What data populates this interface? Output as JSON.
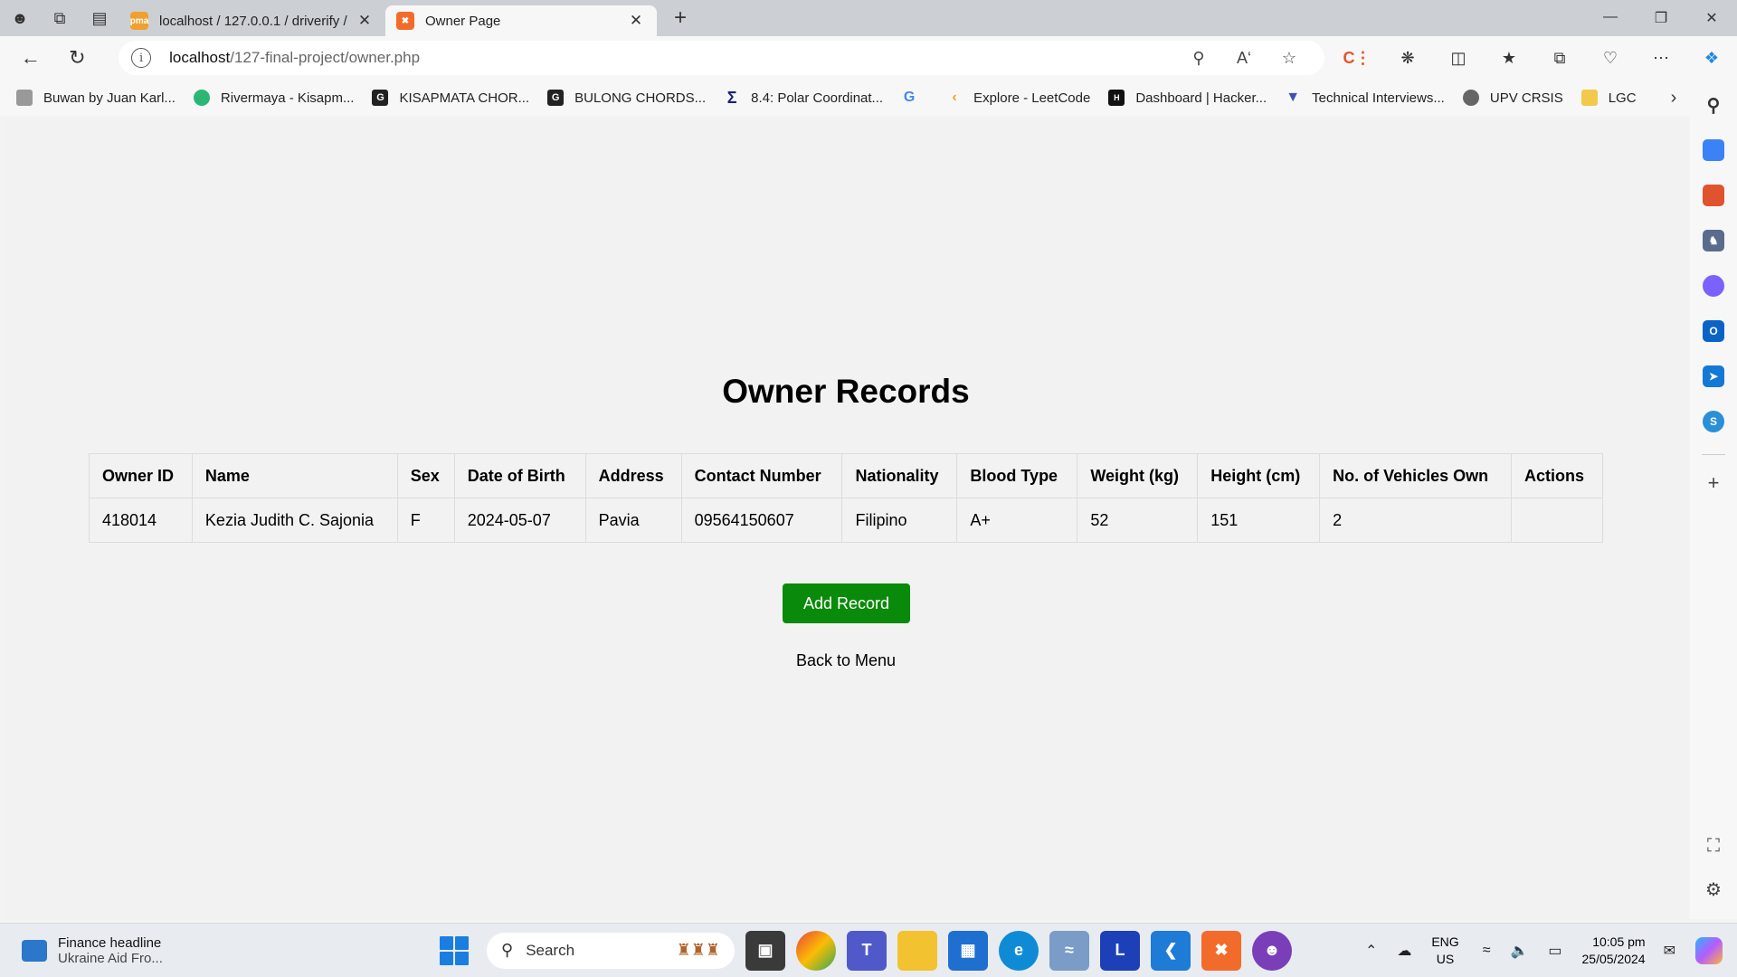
{
  "browser": {
    "tabs": [
      {
        "title": "localhost / 127.0.0.1 / driverify / ",
        "favicon": "phpmyadmin-icon",
        "active": false
      },
      {
        "title": "Owner Page",
        "favicon": "xampp-icon",
        "active": true
      }
    ],
    "url_host": "localhost",
    "url_path": "/127-final-project/owner.php",
    "favorites": [
      {
        "label": "Buwan by Juan Karl...",
        "color": "#999999"
      },
      {
        "label": "Rivermaya - Kisapm...",
        "color": "#2bb673"
      },
      {
        "label": "KISAPMATA CHOR...",
        "color": "#222222"
      },
      {
        "label": "BULONG CHORDS...",
        "color": "#222222"
      },
      {
        "label": "8.4: Polar Coordinat...",
        "color": "#1a237e"
      },
      {
        "label": "",
        "color": "#4285f4"
      },
      {
        "label": "Explore - LeetCode",
        "color": "#f89f1b"
      },
      {
        "label": "Dashboard | Hacker...",
        "color": "#111111"
      },
      {
        "label": "Technical Interviews...",
        "color": "#3f51b5"
      },
      {
        "label": "UPV CRSIS",
        "color": "#666666"
      },
      {
        "label": "LGC",
        "color": "#f2c94c"
      }
    ]
  },
  "page": {
    "title": "Owner Records",
    "columns": [
      "Owner ID",
      "Name",
      "Sex",
      "Date of Birth",
      "Address",
      "Contact Number",
      "Nationality",
      "Blood Type",
      "Weight (kg)",
      "Height (cm)",
      "No. of Vehicles Own",
      "Actions"
    ],
    "rows": [
      [
        "418014",
        "Kezia Judith C. Sajonia",
        "F",
        "2024-05-07",
        "Pavia",
        "09564150607",
        "Filipino",
        "A+",
        "52",
        "151",
        "2",
        ""
      ]
    ],
    "add_button": "Add Record",
    "back_link": "Back to Menu"
  },
  "taskbar": {
    "news_title": "Finance headline",
    "news_sub": "Ukraine Aid Fro...",
    "search_placeholder": "Search",
    "lang_top": "ENG",
    "lang_bottom": "US",
    "time": "10:05 pm",
    "date": "25/05/2024"
  }
}
